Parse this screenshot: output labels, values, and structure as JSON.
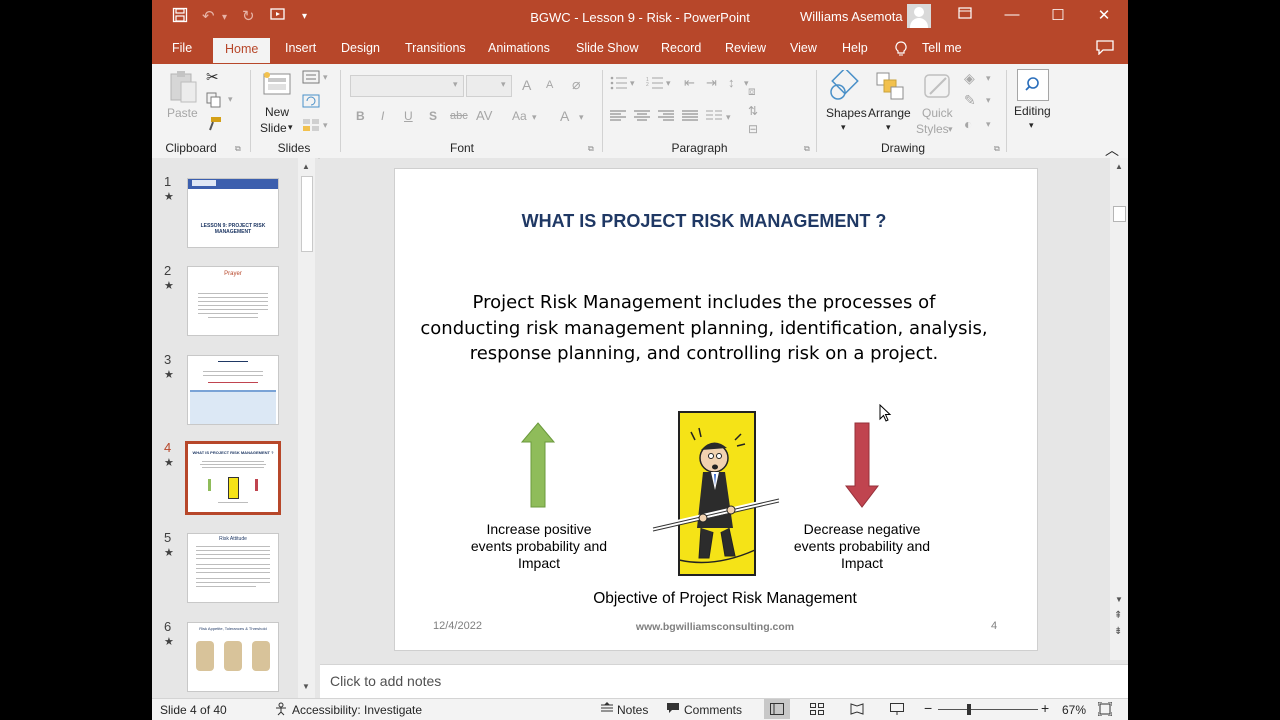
{
  "window": {
    "doc_title": "BGWC - Lesson 9 - Risk  -  PowerPoint",
    "user_name": "Williams Asemota"
  },
  "tabs": [
    "File",
    "Home",
    "Insert",
    "Design",
    "Transitions",
    "Animations",
    "Slide Show",
    "Record",
    "Review",
    "View",
    "Help",
    "Tell me"
  ],
  "ribbon": {
    "clipboard": {
      "paste": "Paste",
      "group": "Clipboard"
    },
    "slides": {
      "new_slide_1": "New",
      "new_slide_2": "Slide",
      "group": "Slides"
    },
    "font": {
      "group": "Font",
      "bold": "B",
      "italic": "I",
      "underline": "U",
      "shadow": "S",
      "strike": "abc",
      "case": "Aa",
      "color": "A",
      "grow": "A",
      "shrink": "A"
    },
    "paragraph": {
      "group": "Paragraph"
    },
    "drawing": {
      "shapes": "Shapes",
      "arrange": "Arrange",
      "quick_styles_1": "Quick",
      "quick_styles_2": "Styles",
      "group": "Drawing"
    },
    "editing": {
      "label": "Editing"
    }
  },
  "thumbnails": [
    {
      "num": "1",
      "title": "LESSON 9: PROJECT RISK MANAGEMENT"
    },
    {
      "num": "2",
      "title": "Prayer"
    },
    {
      "num": "3",
      "title": ""
    },
    {
      "num": "4",
      "title": "WHAT IS PROJECT RISK MANAGEMENT ?"
    },
    {
      "num": "5",
      "title": "Risk Attitude"
    },
    {
      "num": "6",
      "title": "Risk Appetite, Tolerances & Threshold"
    }
  ],
  "slide": {
    "title": "WHAT IS PROJECT RISK MANAGEMENT ?",
    "body_line1": "Project Risk Management includes the processes of",
    "body_line2": "conducting risk  management planning, identification, analysis,",
    "body_line3": "response planning, and controlling risk on a project.",
    "left_caption_1": "Increase positive",
    "left_caption_2": "events probability and",
    "left_caption_3": "Impact",
    "right_caption_1": "Decrease negative",
    "right_caption_2": "events probability and",
    "right_caption_3": "Impact",
    "objective": "Objective of Project Risk Management",
    "footer_date": "12/4/2022",
    "footer_site": "www.bgwilliamsconsulting.com",
    "footer_page": "4",
    "colors": {
      "title": "#1f3864",
      "up_arrow": "#8fbc5a",
      "down_arrow": "#c0444f",
      "figure_bg": "#f5e317"
    }
  },
  "notes_placeholder": "Click to add notes",
  "status": {
    "slide_count": "Slide 4 of 40",
    "accessibility": "Accessibility: Investigate",
    "notes": "Notes",
    "comments": "Comments",
    "zoom": "67%"
  },
  "colors": {
    "accent": "#b7472a"
  }
}
